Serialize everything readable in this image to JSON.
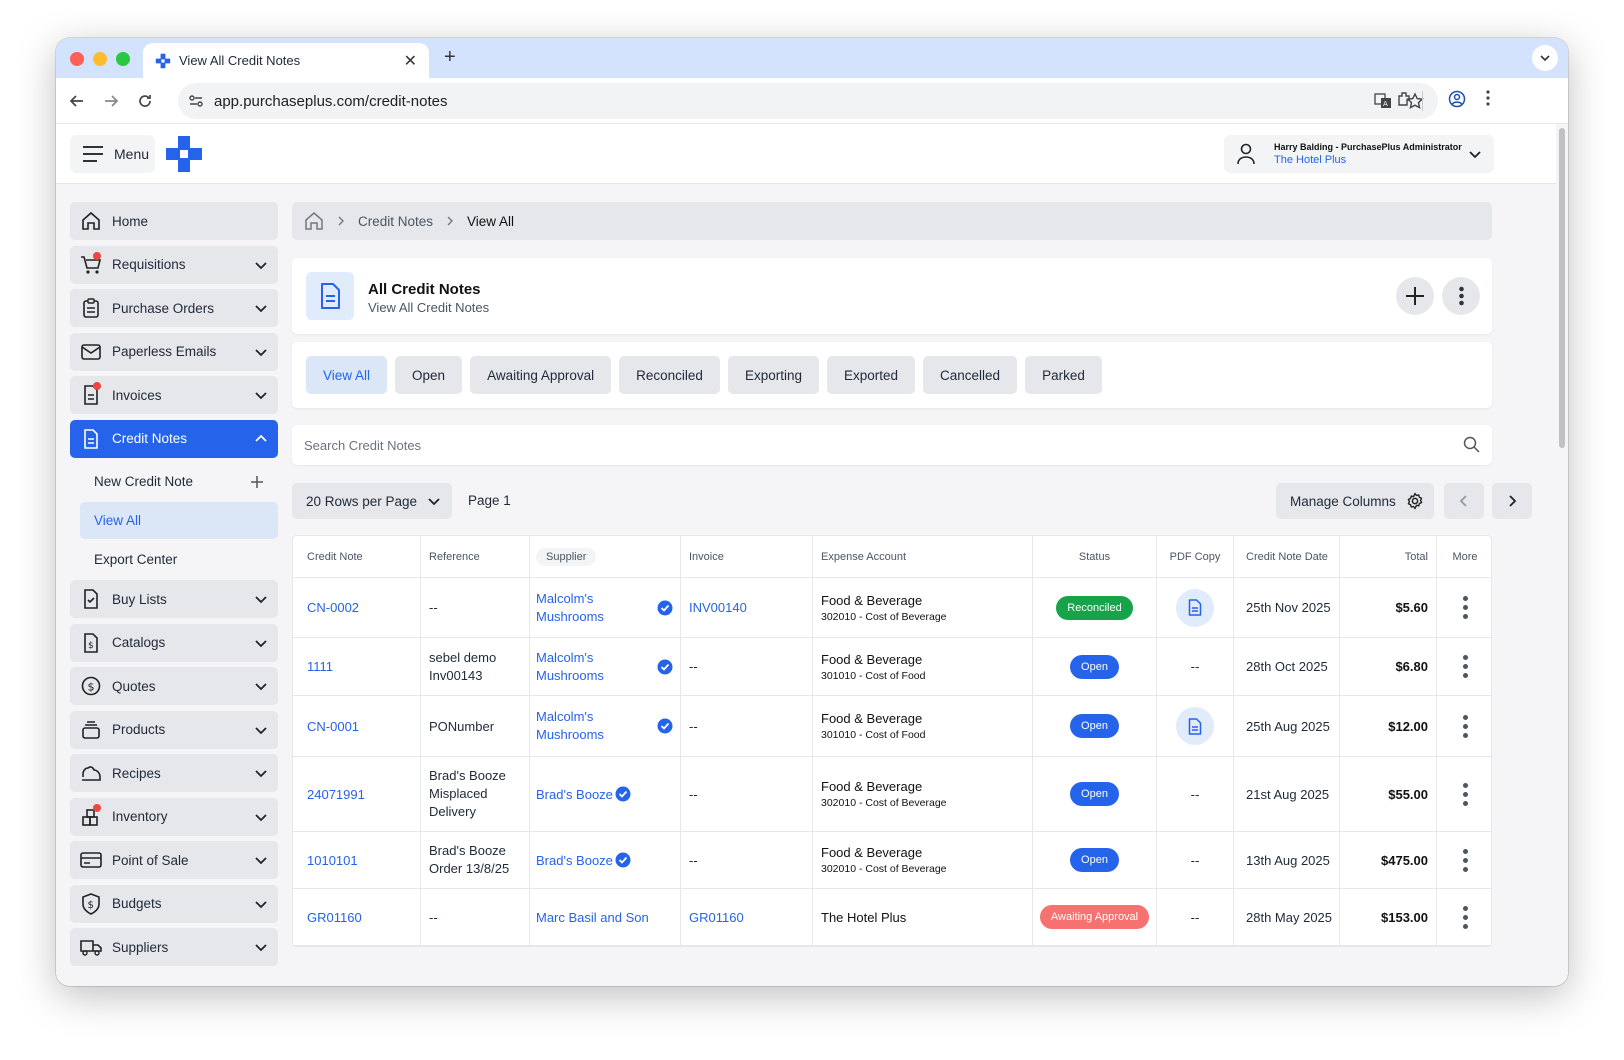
{
  "browser": {
    "tab_title": "View All Credit Notes",
    "url": "app.purchaseplus.com/credit-notes"
  },
  "header": {
    "menu_label": "Menu",
    "user_name": "Harry Balding - PurchasePlus Administrator",
    "user_org": "The Hotel Plus"
  },
  "sidebar": {
    "items": [
      {
        "label": "Home",
        "icon": "home-icon"
      },
      {
        "label": "Requisitions",
        "icon": "cart-icon"
      },
      {
        "label": "Purchase Orders",
        "icon": "clipboard-icon"
      },
      {
        "label": "Paperless Emails",
        "icon": "mail-icon"
      },
      {
        "label": "Invoices",
        "icon": "invoice-icon"
      },
      {
        "label": "Credit Notes",
        "icon": "document-icon"
      }
    ],
    "sub_items": [
      {
        "label": "New Credit Note"
      },
      {
        "label": "View All"
      },
      {
        "label": "Export Center"
      }
    ],
    "items_after": [
      {
        "label": "Buy Lists",
        "icon": "checklist-icon"
      },
      {
        "label": "Catalogs",
        "icon": "catalog-icon"
      },
      {
        "label": "Quotes",
        "icon": "dollar-icon"
      },
      {
        "label": "Products",
        "icon": "products-icon"
      },
      {
        "label": "Recipes",
        "icon": "recipe-icon"
      },
      {
        "label": "Inventory",
        "icon": "inventory-icon"
      },
      {
        "label": "Point of Sale",
        "icon": "card-icon"
      },
      {
        "label": "Budgets",
        "icon": "shield-dollar-icon"
      },
      {
        "label": "Suppliers",
        "icon": "truck-icon"
      }
    ]
  },
  "breadcrumb": {
    "items": [
      "Credit Notes",
      "View All"
    ]
  },
  "title_card": {
    "title": "All Credit Notes",
    "subtitle": "View All Credit Notes"
  },
  "filters": [
    "View All",
    "Open",
    "Awaiting Approval",
    "Reconciled",
    "Exporting",
    "Exported",
    "Cancelled",
    "Parked"
  ],
  "search": {
    "placeholder": "Search Credit Notes"
  },
  "toolbar": {
    "rows_per_page": "20 Rows per Page",
    "page_label": "Page 1",
    "manage_columns": "Manage Columns"
  },
  "table": {
    "headers": [
      "Credit Note",
      "Reference",
      "Supplier",
      "Invoice",
      "Expense Account",
      "Status",
      "PDF Copy",
      "Credit Note Date",
      "Total",
      "More"
    ],
    "rows": [
      {
        "credit_note": "CN-0002",
        "reference": "--",
        "supplier": "Malcolm's Mushrooms",
        "verified": true,
        "invoice": "INV00140",
        "invoice_link": true,
        "ea_main": "Food & Beverage",
        "ea_sub": "302010 - Cost of Beverage",
        "status": "Reconciled",
        "status_kind": "rec",
        "pdf": true,
        "date": "25th Nov 2025",
        "total": "$5.60"
      },
      {
        "credit_note": "1111",
        "reference": "sebel demo Inv00143",
        "supplier": "Malcolm's Mushrooms",
        "verified": true,
        "invoice": "--",
        "invoice_link": false,
        "ea_main": "Food & Beverage",
        "ea_sub": "301010 - Cost of Food",
        "status": "Open",
        "status_kind": "open",
        "pdf": false,
        "date": "28th Oct 2025",
        "total": "$6.80"
      },
      {
        "credit_note": "CN-0001",
        "reference": "PONumber",
        "supplier": "Malcolm's Mushrooms",
        "verified": true,
        "invoice": "--",
        "invoice_link": false,
        "ea_main": "Food & Beverage",
        "ea_sub": "301010 - Cost of Food",
        "status": "Open",
        "status_kind": "open",
        "pdf": true,
        "date": "25th Aug 2025",
        "total": "$12.00"
      },
      {
        "credit_note": "24071991",
        "reference": "Brad's Booze Misplaced Delivery",
        "supplier": "Brad's Booze",
        "verified": true,
        "invoice": "--",
        "invoice_link": false,
        "ea_main": "Food & Beverage",
        "ea_sub": "302010 - Cost of Beverage",
        "status": "Open",
        "status_kind": "open",
        "pdf": false,
        "date": "21st Aug 2025",
        "total": "$55.00"
      },
      {
        "credit_note": "1010101",
        "reference": "Brad's Booze Order 13/8/25",
        "supplier": "Brad's Booze",
        "verified": true,
        "invoice": "--",
        "invoice_link": false,
        "ea_main": "Food & Beverage",
        "ea_sub": "302010 - Cost of Beverage",
        "status": "Open",
        "status_kind": "open",
        "pdf": false,
        "date": "13th Aug 2025",
        "total": "$475.00"
      },
      {
        "credit_note": "GR01160",
        "reference": "--",
        "supplier": "Marc Basil and Son",
        "verified": false,
        "invoice": "GR01160",
        "invoice_link": true,
        "ea_main": "The Hotel Plus",
        "ea_sub": "",
        "status": "Awaiting Approval",
        "status_kind": "aw",
        "pdf": false,
        "date": "28th May 2025",
        "total": "$153.00"
      }
    ],
    "empty_pdf": "--"
  },
  "colors": {
    "primary": "#2563eb",
    "reconciled": "#16a34a",
    "awaiting": "#f87171"
  }
}
